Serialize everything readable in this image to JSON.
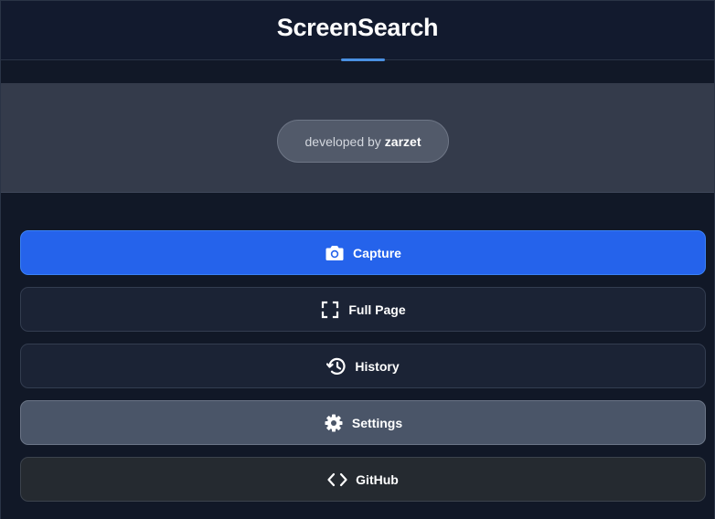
{
  "header": {
    "title": "ScreenSearch"
  },
  "banner": {
    "credit_prefix": "developed by",
    "credit_author": "zarzet"
  },
  "actions": [
    {
      "label": "Capture",
      "icon": "camera-icon",
      "color": "#2563eb"
    },
    {
      "label": "Full Page",
      "icon": "fullscreen-frame-icon",
      "color": "#1b2335"
    },
    {
      "label": "History",
      "icon": "history-icon",
      "color": "#1b2335"
    },
    {
      "label": "Settings",
      "icon": "gear-icon",
      "color": "#4a5568"
    },
    {
      "label": "GitHub",
      "icon": "code-brackets-icon",
      "color": "#252a30"
    }
  ],
  "colors": {
    "background": "#111827",
    "accent": "#4a90e2",
    "primary": "#2563eb"
  }
}
